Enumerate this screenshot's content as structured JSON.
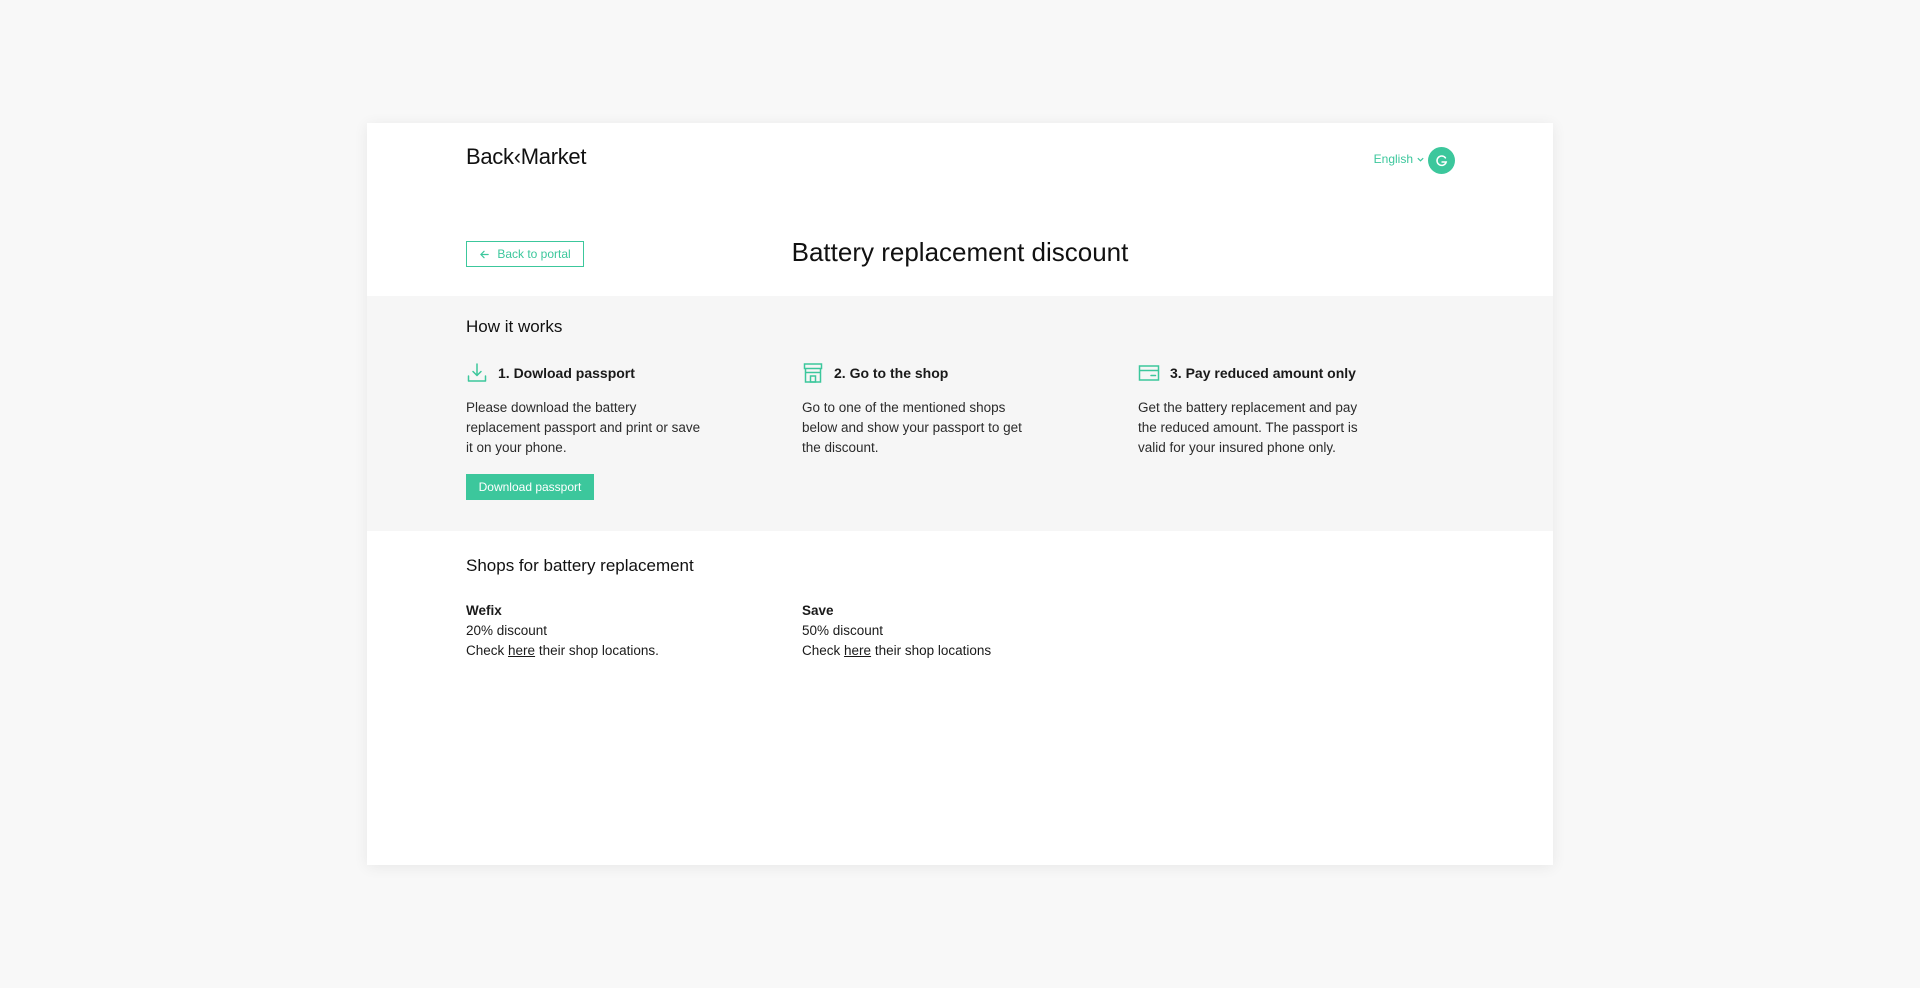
{
  "header": {
    "logo": "Back‹Market",
    "language": "English",
    "avatar_icon": "grammarly-icon"
  },
  "page": {
    "back_label": "Back to portal",
    "title": "Battery replacement discount"
  },
  "how_it_works": {
    "title": "How it works",
    "steps": [
      {
        "icon": "download-icon",
        "title": "1. Dowload passport",
        "desc": "Please download the battery replacement passport and print or save it on your phone."
      },
      {
        "icon": "shop-icon",
        "title": "2. Go to the shop",
        "desc": "Go to one of the mentioned shops below and show your passport to get the discount."
      },
      {
        "icon": "credit-card-icon",
        "title": "3. Pay reduced amount only",
        "desc": "Get the battery replacement and pay the reduced amount. The passport is valid for your insured phone only."
      }
    ],
    "download_button": "Download passport"
  },
  "shops": {
    "title": "Shops for battery replacement",
    "items": [
      {
        "name": "Wefix",
        "discount": "20% discount",
        "check_prefix": "Check",
        "link": "here",
        "check_suffix": "their shop locations."
      },
      {
        "name": "Save",
        "discount": "50% discount",
        "check_prefix": "Check",
        "link": "here",
        "check_suffix": "their shop locations"
      }
    ]
  },
  "colors": {
    "accent": "#3cc79c",
    "background": "#f8f8f8",
    "section_background": "#f6f6f6"
  }
}
